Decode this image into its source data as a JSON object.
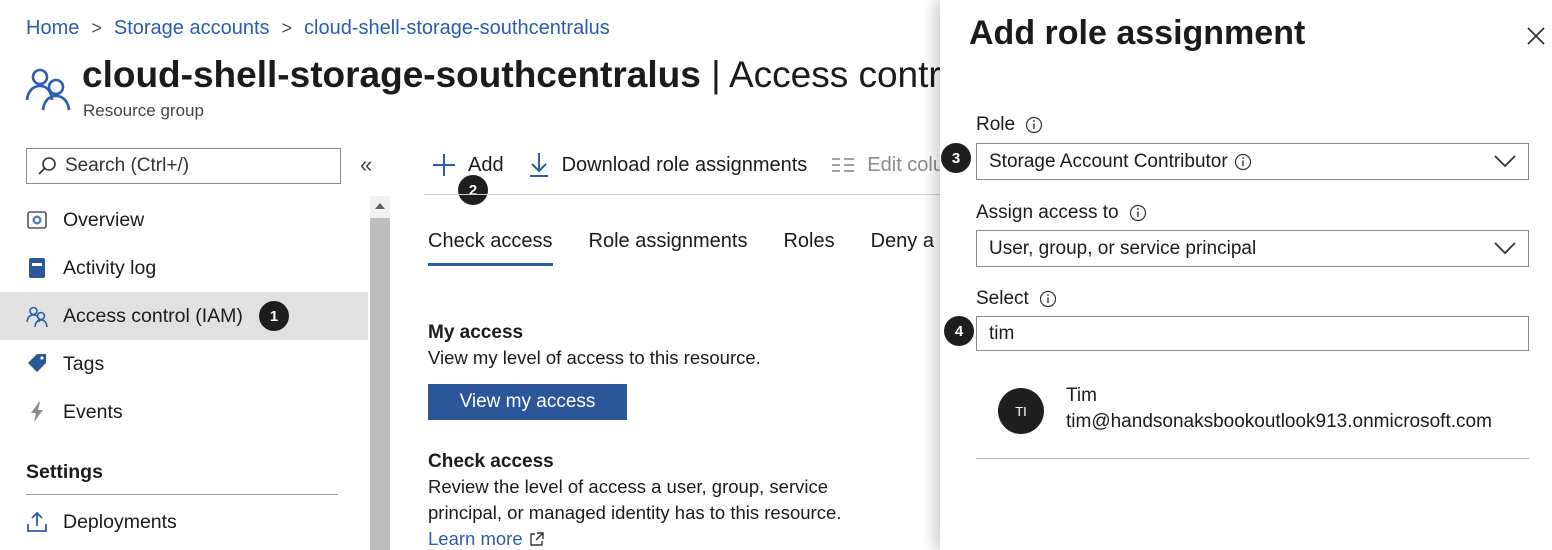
{
  "breadcrumb": {
    "items": [
      "Home",
      "Storage accounts",
      "cloud-shell-storage-southcentralus"
    ]
  },
  "header": {
    "title_bold": "cloud-shell-storage-southcentralus",
    "title_rest": " | Access control (I",
    "subtitle": "Resource group"
  },
  "sidebar": {
    "search_placeholder": "Search (Ctrl+/)",
    "collapse_label": "«",
    "items": [
      {
        "label": "Overview",
        "icon": "overview-icon"
      },
      {
        "label": "Activity log",
        "icon": "activity-log-icon"
      },
      {
        "label": "Access control (IAM)",
        "icon": "iam-icon",
        "active": true
      },
      {
        "label": "Tags",
        "icon": "tag-icon"
      },
      {
        "label": "Events",
        "icon": "events-icon"
      }
    ],
    "settings_heading": "Settings",
    "settings_items": [
      {
        "label": "Deployments",
        "icon": "deployments-icon"
      }
    ]
  },
  "toolbar": {
    "add_label": "Add",
    "download_label": "Download role assignments",
    "edit_columns_label": "Edit colu"
  },
  "tabs": [
    "Check access",
    "Role assignments",
    "Roles",
    "Deny a"
  ],
  "my_access": {
    "title": "My access",
    "description": "View my level of access to this resource.",
    "button": "View my access"
  },
  "check_access": {
    "title": "Check access",
    "description_line1": "Review the level of access a user, group, service",
    "description_line2": "principal, or managed identity has to this resource.",
    "learn_more": "Learn more"
  },
  "panel": {
    "title": "Add role assignment",
    "role_label": "Role",
    "role_value": "Storage Account Contributor",
    "assign_label": "Assign access to",
    "assign_value": "User, group, or service principal",
    "select_label": "Select",
    "select_value": "tim",
    "result": {
      "initials": "TI",
      "name": "Tim",
      "email": "tim@handsonaksbookoutlook913.onmicrosoft.com"
    }
  },
  "callouts": [
    "1",
    "2",
    "3",
    "4"
  ],
  "colors": {
    "link": "#2a5db0",
    "primary_button": "#2b579a",
    "active_nav": "#e1e1e1",
    "badge": "#1e1e1e"
  }
}
